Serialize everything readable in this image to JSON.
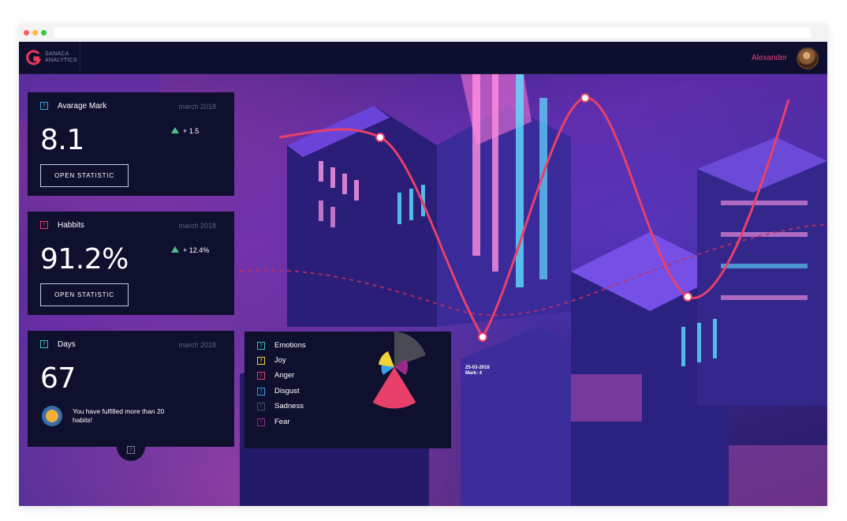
{
  "app": {
    "brand_line1": "SANACA",
    "brand_line2": "ANALYTICS",
    "brand_color": "#e83a5a",
    "user_name": "Alexander"
  },
  "cards": [
    {
      "title": "Avarage Mark",
      "date": "march 2018",
      "value": "8.1",
      "delta": "+ 1.5",
      "button": "OPEN STATISTIC",
      "icon_color": "#3aa0e8"
    },
    {
      "title": "Habbits",
      "date": "march 2018",
      "value": "91.2%",
      "delta": "+ 12.4%",
      "button": "OPEN STATISTIC",
      "icon_color": "#e83a6a"
    },
    {
      "title": "Days",
      "date": "march 2018",
      "value": "67",
      "achievement": "You have fulfilled more than 20 habits!",
      "icon_color": "#3ac0c0"
    }
  ],
  "emotions": {
    "items": [
      {
        "label": "Emotions",
        "color": "#3ac0c0"
      },
      {
        "label": "Joy",
        "color": "#f2d23a"
      },
      {
        "label": "Anger",
        "color": "#e8406a"
      },
      {
        "label": "Disgust",
        "color": "#3aa0e8"
      },
      {
        "label": "Sadness",
        "color": "#4a4a6a"
      },
      {
        "label": "Fear",
        "color": "#9a2a8a"
      }
    ]
  },
  "line_chart": {
    "point_label_date": "25-03-2018",
    "point_label_mark": "Mark: 4",
    "line_color": "#e8406a"
  },
  "icons": {
    "help": "?"
  }
}
